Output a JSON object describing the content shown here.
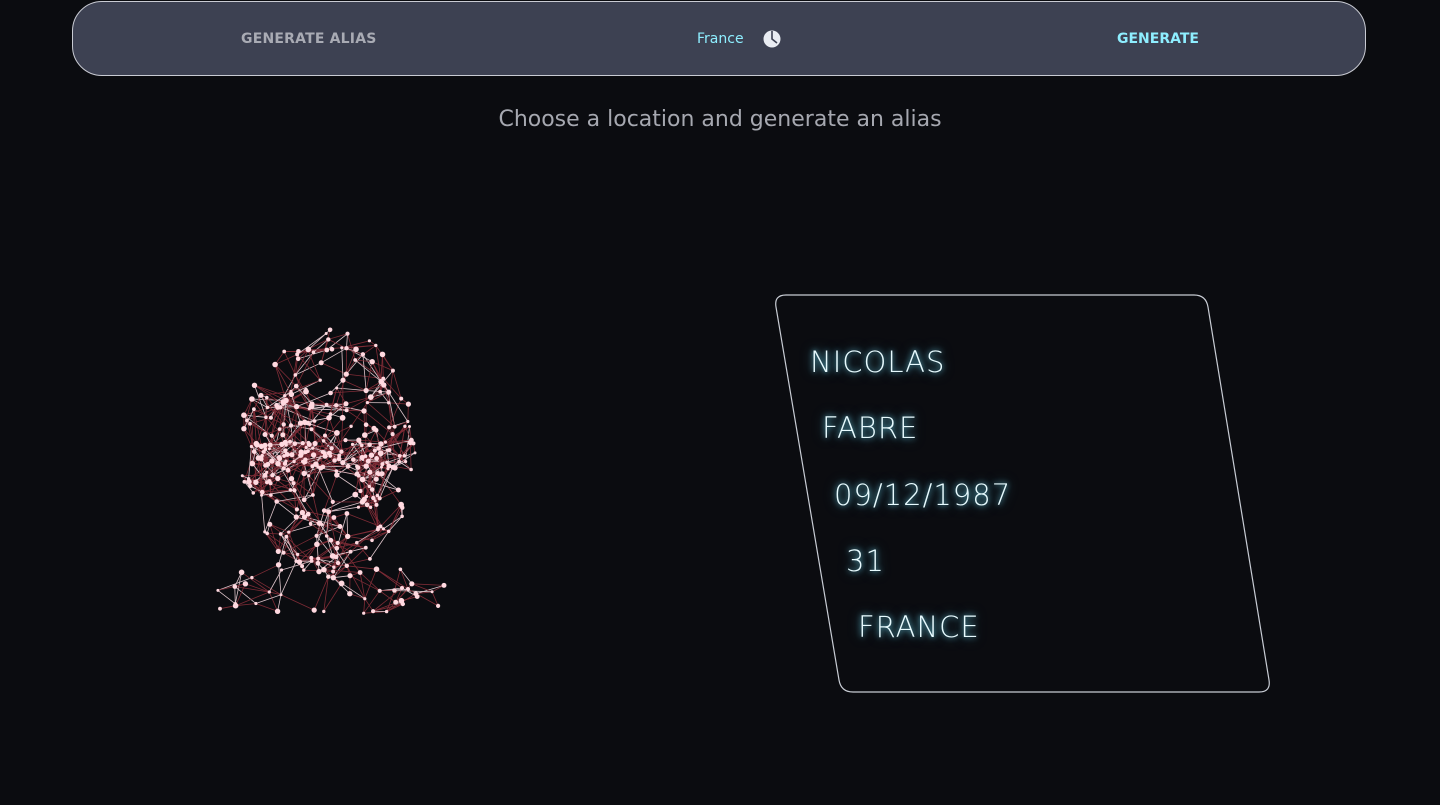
{
  "header": {
    "title": "GENERATE ALIAS",
    "country": "France",
    "globe_icon": "globe-icon",
    "generate_label": "GENERATE"
  },
  "subtitle": "Choose a location and generate an alias",
  "alias_card": {
    "first_name": "NICOLAS",
    "last_name": "FABRE",
    "birth_date": "09/12/1987",
    "age": "31",
    "country": "FRANCE"
  },
  "face_visual": {
    "icon": "wireframe-face-icon"
  },
  "colors": {
    "background": "#0b0c10",
    "topbar": "#3d4152",
    "accent": "#8eeeff",
    "muted_text": "#a6a8b0",
    "mesh_point": "#ffd9e0",
    "mesh_line": "#8a2f3a"
  }
}
